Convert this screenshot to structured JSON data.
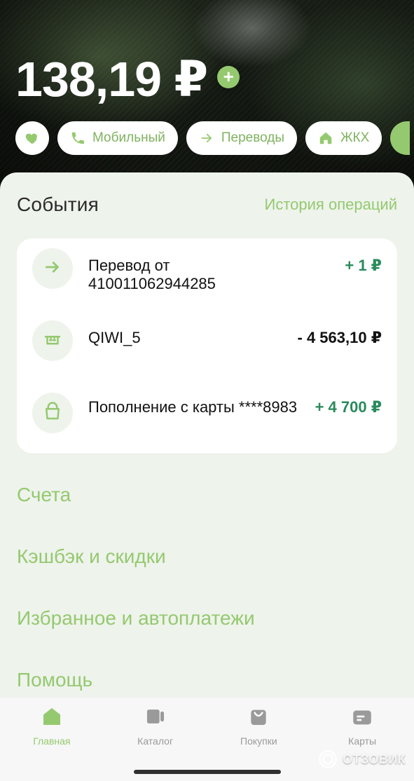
{
  "header": {
    "balance": "138,19 ₽",
    "add_symbol": "+"
  },
  "quick_actions": {
    "items": [
      {
        "label": "",
        "icon": "heart-icon"
      },
      {
        "label": "Мобильный",
        "icon": "phone-icon"
      },
      {
        "label": "Переводы",
        "icon": "arrow-right-icon"
      },
      {
        "label": "ЖКХ",
        "icon": "home-icon"
      },
      {
        "label": "",
        "icon": "partial-pill"
      }
    ]
  },
  "events": {
    "title": "События",
    "history_link": "История операций",
    "items": [
      {
        "icon": "arrow-right-icon",
        "title": "Перевод от 410011062944285",
        "amount": "+ 1 ₽",
        "amount_type": "pos"
      },
      {
        "icon": "store-icon",
        "title": "QIWI_5",
        "amount": "- 4 563,10 ₽",
        "amount_type": "neg"
      },
      {
        "icon": "bag-icon",
        "title": "Пополнение с карты ****8983",
        "amount": "+ 4 700 ₽",
        "amount_type": "pos"
      }
    ]
  },
  "menu": {
    "items": [
      {
        "label": "Счета"
      },
      {
        "label": "Кэшбэк и скидки"
      },
      {
        "label": "Избранное и автоплатежи"
      },
      {
        "label": "Помощь"
      }
    ]
  },
  "bottom_nav": {
    "tabs": [
      {
        "label": "Главная",
        "icon": "home-tab-icon",
        "active": true
      },
      {
        "label": "Каталог",
        "icon": "catalog-tab-icon",
        "active": false
      },
      {
        "label": "Покупки",
        "icon": "purchases-tab-icon",
        "active": false
      },
      {
        "label": "Карты",
        "icon": "cards-tab-icon",
        "active": false
      }
    ]
  },
  "watermark": {
    "text": "ОТЗОВИК"
  },
  "colors": {
    "accent": "#95c96f",
    "positive_amount": "#2a8a5b"
  }
}
